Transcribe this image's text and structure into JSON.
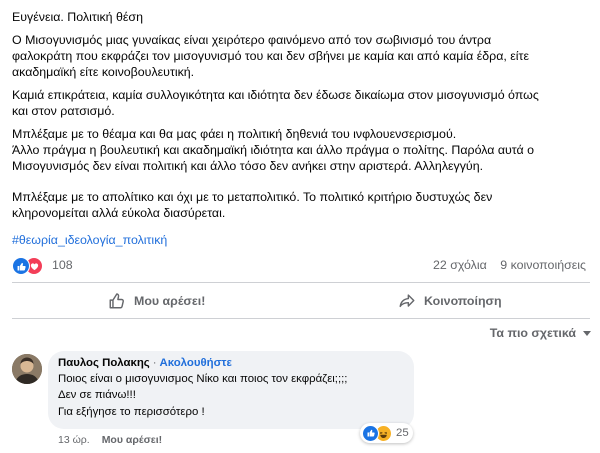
{
  "post": {
    "paragraphs": [
      [
        "Ευγένεια. Πολιτική θέση"
      ],
      [
        "Ο Μισογυνισμός μιας γυναίκας είναι χειρότερο φαινόμενο από τον σωβινισμό του άντρα",
        "φαλοκράτη που εκφράζει τον μισογυνισμό του και δεν σβήνει με καμία και από καμία έδρα, είτε",
        "ακαδημαϊκή είτε κοινοβουλευτική."
      ],
      [
        "Καμιά επικράτεια, καμία συλλογικότητα και ιδιότητα δεν έδωσε δικαίωμα στον μισογυνισμό όπως",
        "και στον ρατσισμό."
      ],
      [
        "Μπλέξαμε με το θέαμα και θα μας φάει η πολιτική δηθενιά του ινφλουενσερισμού.",
        "Άλλο πράγμα η βουλευτική και ακαδημαϊκή ιδιότητα και άλλο πράγμα ο πολίτης. Παρόλα  αυτά ο",
        "Μισογυνισμός δεν είναι πολιτική και άλλο τόσο δεν ανήκει στην αριστερά. Αλληλεγγύη."
      ],
      [
        "Μπλέξαμε με το απολίτικο και όχι με το μεταπολιτικό. Το πολιτικό κριτήριο δυστυχώς δεν",
        "κληρονομείται αλλά εύκολα διασύρεται."
      ]
    ],
    "hashtag": "#θεωρία_ιδεολογία_πολιτική"
  },
  "reactions": {
    "count": "108",
    "comments": "22 σχόλια",
    "shares": "9 κοινοποιήσεις",
    "icons": [
      "like-icon",
      "love-icon"
    ],
    "colors": {
      "like": "#1b74e4",
      "love": "#f33e58"
    }
  },
  "actions": {
    "like_label": "Μου αρέσει!",
    "share_label": "Κοινοποίηση"
  },
  "sort": {
    "label": "Τα πιο σχετικά"
  },
  "comment": {
    "author": "Παυλος Πολακης",
    "separator": "·",
    "follow_label": "Ακολουθήστε",
    "lines": [
      "Ποιος είναι ο μισογυνισμος Νίκο και ποιος τον εκφράζει;;;;",
      "Δεν σε πιάνω!!!",
      "Για εξήγησε το περισσότερο !"
    ],
    "reaction_count": "25",
    "reaction_icons": [
      "like-icon",
      "haha-icon"
    ],
    "time": "13 ώρ.",
    "like_label": "Μου αρέσει!"
  }
}
